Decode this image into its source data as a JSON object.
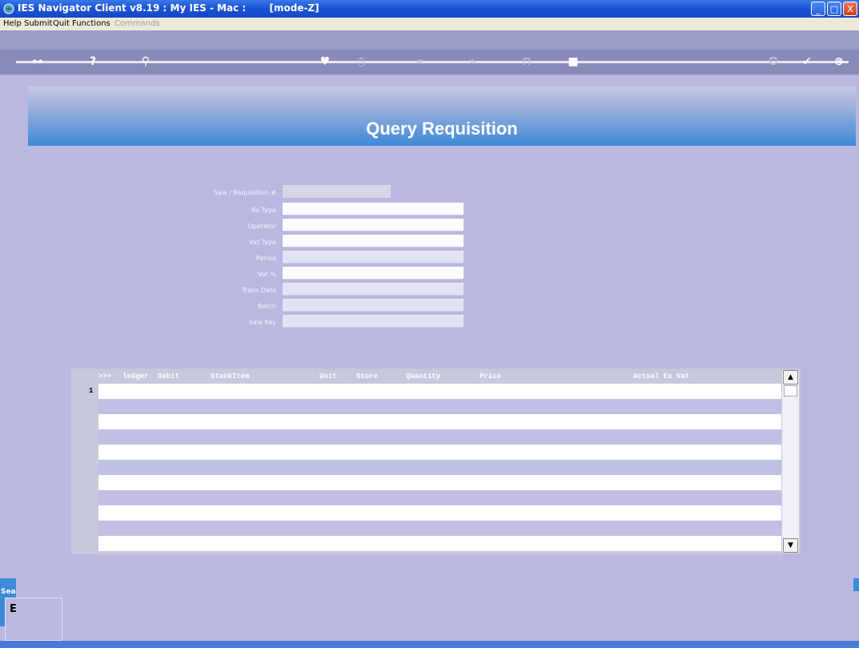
{
  "window": {
    "title": "IES Navigator Client v8.19 : My IES - Mac :       [mode-Z]",
    "minimize_glyph": "_",
    "maximize_glyph": "□",
    "close_glyph": "X"
  },
  "menu": [
    {
      "label": "Help",
      "enabled": true
    },
    {
      "label": "Submit",
      "enabled": true
    },
    {
      "label": "Quit",
      "enabled": true
    },
    {
      "label": "Functions",
      "enabled": true
    },
    {
      "label": "Commands",
      "enabled": false
    }
  ],
  "toolbar": {
    "icons": [
      "key-icon",
      "help-icon",
      "search-icon",
      "heart-icon",
      "clock-icon",
      "back-icon",
      "forward-icon",
      "split-icon",
      "stop-icon",
      "settings-icon",
      "check-icon",
      "close-icon"
    ]
  },
  "page": {
    "title": "Query Requisition"
  },
  "form": {
    "fields": [
      {
        "label": "Sale / Requisition #",
        "value": ""
      },
      {
        "label": "Rs Type",
        "value": ""
      },
      {
        "label": "Operator",
        "value": ""
      },
      {
        "label": "Vat Type",
        "value": ""
      },
      {
        "label": "Period",
        "value": ""
      },
      {
        "label": "Vat %",
        "value": ""
      },
      {
        "label": "Trans Date",
        "value": ""
      },
      {
        "label": "Batch",
        "value": ""
      },
      {
        "label": "Sale Key",
        "value": ""
      }
    ]
  },
  "grid": {
    "columns": [
      ">>>",
      "ledger",
      "Debit",
      "StockItem",
      "Unit",
      "Store",
      "Quantity",
      "Price",
      "Actual Ex Vat"
    ],
    "first_row_number": "1",
    "scroll_up": "▲",
    "scroll_down": "▼"
  },
  "bottom_panel": {
    "label": "Sea",
    "value": "E"
  },
  "colors": {
    "background": "#b8b8e0",
    "banner_blue": "#3c8ad8",
    "titlebar": "#1c54d6"
  }
}
